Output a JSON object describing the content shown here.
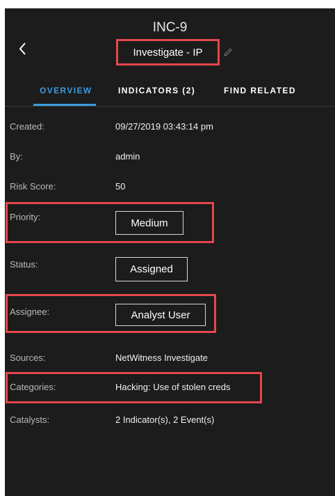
{
  "header": {
    "incident_id": "INC-9",
    "title": "Investigate - IP",
    "back_icon": "chevron-left-icon",
    "edit_icon": "pencil-icon"
  },
  "tabs": [
    {
      "label": "OVERVIEW",
      "active": true
    },
    {
      "label": "INDICATORS (2)",
      "active": false
    },
    {
      "label": "FIND RELATED",
      "active": false
    }
  ],
  "details": {
    "created": {
      "label": "Created:",
      "value": "09/27/2019 03:43:14 pm"
    },
    "by": {
      "label": "By:",
      "value": "admin"
    },
    "risk_score": {
      "label": "Risk Score:",
      "value": "50"
    },
    "priority": {
      "label": "Priority:",
      "value": "Medium"
    },
    "status": {
      "label": "Status:",
      "value": "Assigned"
    },
    "assignee": {
      "label": "Assignee:",
      "value": "Analyst User"
    },
    "sources": {
      "label": "Sources:",
      "value": "NetWitness Investigate"
    },
    "categories": {
      "label": "Categories:",
      "value": "Hacking:  Use of stolen creds"
    },
    "catalysts": {
      "label": "Catalysts:",
      "value": "2 Indicator(s), 2 Event(s)"
    }
  },
  "colors": {
    "panel_bg": "#1c1c1c",
    "accent": "#3b9be0",
    "highlight": "#e4474c"
  }
}
